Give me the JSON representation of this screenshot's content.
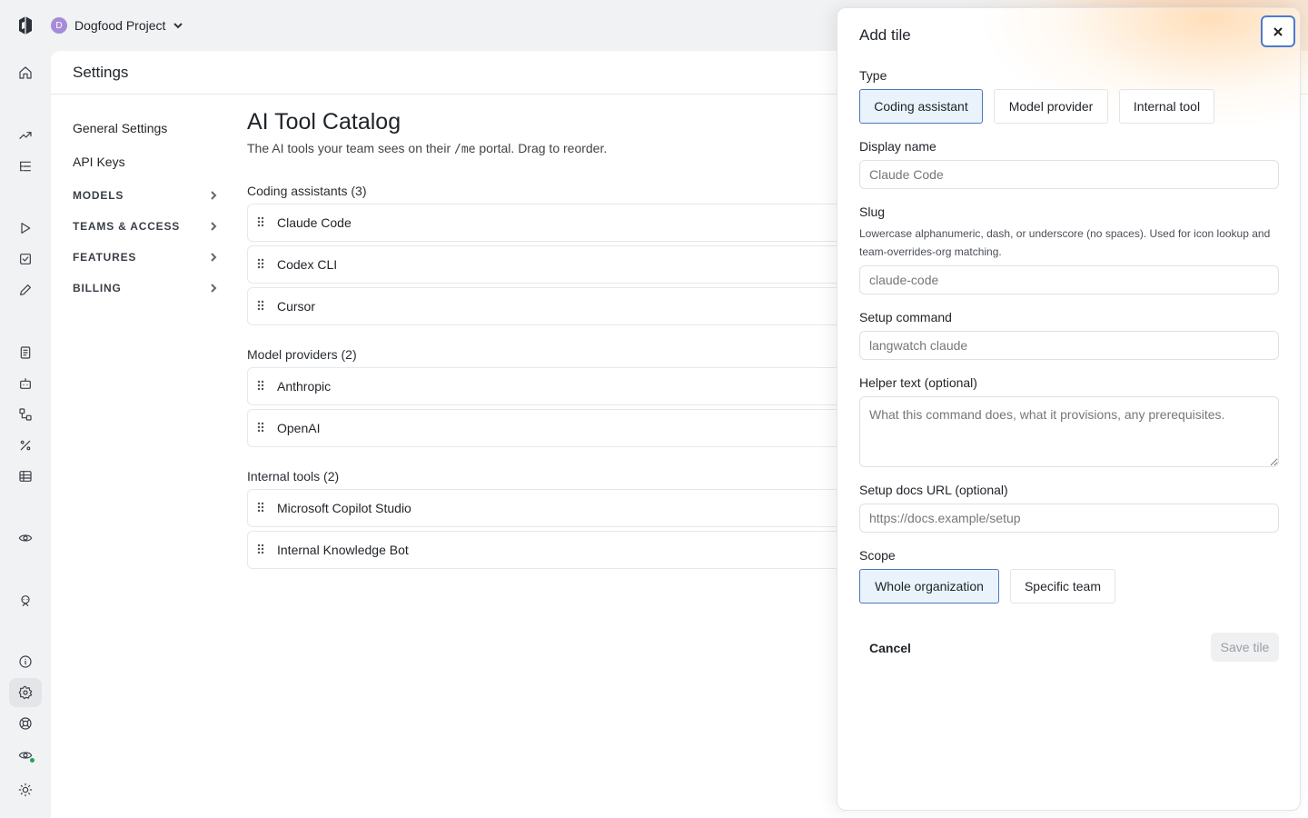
{
  "project": {
    "avatar_letter": "D",
    "name": "Dogfood Project"
  },
  "settings": {
    "title": "Settings",
    "subnav": [
      {
        "label": "General Settings",
        "type": "link"
      },
      {
        "label": "API Keys",
        "type": "link"
      },
      {
        "label": "MODELS",
        "type": "section"
      },
      {
        "label": "TEAMS & ACCESS",
        "type": "section"
      },
      {
        "label": "FEATURES",
        "type": "section"
      },
      {
        "label": "BILLING",
        "type": "section"
      }
    ]
  },
  "catalog": {
    "title": "AI Tool Catalog",
    "desc_before": "The AI tools your team sees on their ",
    "desc_code": "/me",
    "desc_after": " portal. Drag to reorder.",
    "groups": [
      {
        "title": "Coding assistants (3)",
        "items": [
          "Claude Code",
          "Codex CLI",
          "Cursor"
        ]
      },
      {
        "title": "Model providers (2)",
        "items": [
          "Anthropic",
          "OpenAI"
        ]
      },
      {
        "title": "Internal tools (2)",
        "items": [
          "Microsoft Copilot Studio",
          "Internal Knowledge Bot"
        ]
      }
    ]
  },
  "drawer": {
    "title": "Add tile",
    "type_label": "Type",
    "type_options": [
      "Coding assistant",
      "Model provider",
      "Internal tool"
    ],
    "type_selected": "Coding assistant",
    "display_name_label": "Display name",
    "display_name_placeholder": "Claude Code",
    "slug_label": "Slug",
    "slug_help": "Lowercase alphanumeric, dash, or underscore (no spaces). Used for icon lookup and team-overrides-org matching.",
    "slug_placeholder": "claude-code",
    "setup_command_label": "Setup command",
    "setup_command_placeholder": "langwatch claude",
    "helper_text_label": "Helper text (optional)",
    "helper_text_placeholder": "What this command does, what it provisions, any prerequisites.",
    "docs_url_label": "Setup docs URL (optional)",
    "docs_url_placeholder": "https://docs.example/setup",
    "scope_label": "Scope",
    "scope_options": [
      "Whole organization",
      "Specific team"
    ],
    "scope_selected": "Whole organization",
    "cancel_label": "Cancel",
    "save_label": "Save tile"
  },
  "colors": {
    "selected_bg": "#eaf3fb",
    "selected_border": "#4b78b8",
    "focus_ring": "#4a7bd0",
    "status_green": "#22a35a",
    "avatar": "#a78bda"
  }
}
